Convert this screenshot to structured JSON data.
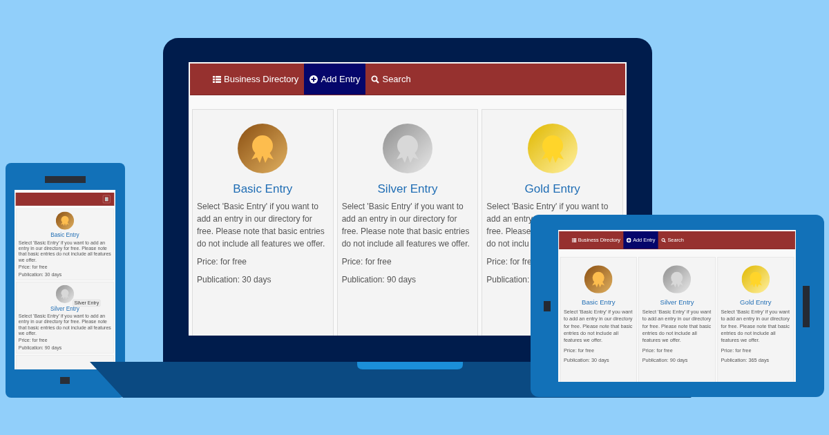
{
  "laptop": {
    "nav": [
      {
        "label": "Business Directory",
        "selected": false
      },
      {
        "label": "Add Entry",
        "selected": true
      },
      {
        "label": "Search",
        "selected": false
      }
    ],
    "cards": [
      {
        "title": "Basic Entry",
        "lines": [
          "Select 'Basic Entry' if you want to",
          "add an entry in our directory for",
          "free. Please note that basic entries",
          "do not include all features we offer."
        ],
        "price": "Price: for free",
        "publication": "Publication: 30 days"
      },
      {
        "title": "Silver Entry",
        "lines": [
          "Select 'Basic Entry' if you want to",
          "add an entry in our directory for",
          "free. Please note that basic entries",
          "do not include all features we offer."
        ],
        "price": "Price: for free",
        "publication": "Publication: 90 days"
      },
      {
        "title": "Gold Entry",
        "lines": [
          "Select 'Basic Entry' if you want to",
          "add an entry",
          "free. Please",
          "do not inclu"
        ],
        "price": "Price: for fre",
        "publication": "Publication:"
      }
    ]
  },
  "phone": {
    "cards": [
      {
        "title": "Basic Entry",
        "description": "Select 'Basic Entry' if you want to add an entry in our directory for free. Please note that basic entries do not include all features we offer.",
        "price": "Price: for free",
        "publication": "Publication: 30 days"
      },
      {
        "title": "Silver Entry",
        "tooltip": "Silver Entry",
        "description": "Select 'Basic Entry' if you want to add an entry in our directory for free. Please note that basic entries do not include all features we offer.",
        "price": "Price: for free",
        "publication": "Publication: 90 days"
      }
    ]
  },
  "tablet": {
    "nav": [
      {
        "label": "Business Directory",
        "selected": false
      },
      {
        "label": "Add Entry",
        "selected": true
      },
      {
        "label": "Search",
        "selected": false
      }
    ],
    "cards": [
      {
        "title": "Basic Entry",
        "description": "Select 'Basic Entry' if you want to add an entry in our directory for free. Please note that basic entries do not include all features we offer.",
        "price": "Price: for free",
        "publication": "Publication: 30 days"
      },
      {
        "title": "Silver Entry",
        "description": "Select 'Basic Entry' if you want to add an entry in our directory for free. Please note that basic entries do not include all features we offer.",
        "price": "Price: for free",
        "publication": "Publication: 90 days"
      },
      {
        "title": "Gold Entry",
        "description": "Select 'Basic Entry' if you want to add an entry in our directory for free. Please note that basic entries do not include all features we offer.",
        "price": "Price: for free",
        "publication": "Publication: 365 days"
      }
    ]
  }
}
